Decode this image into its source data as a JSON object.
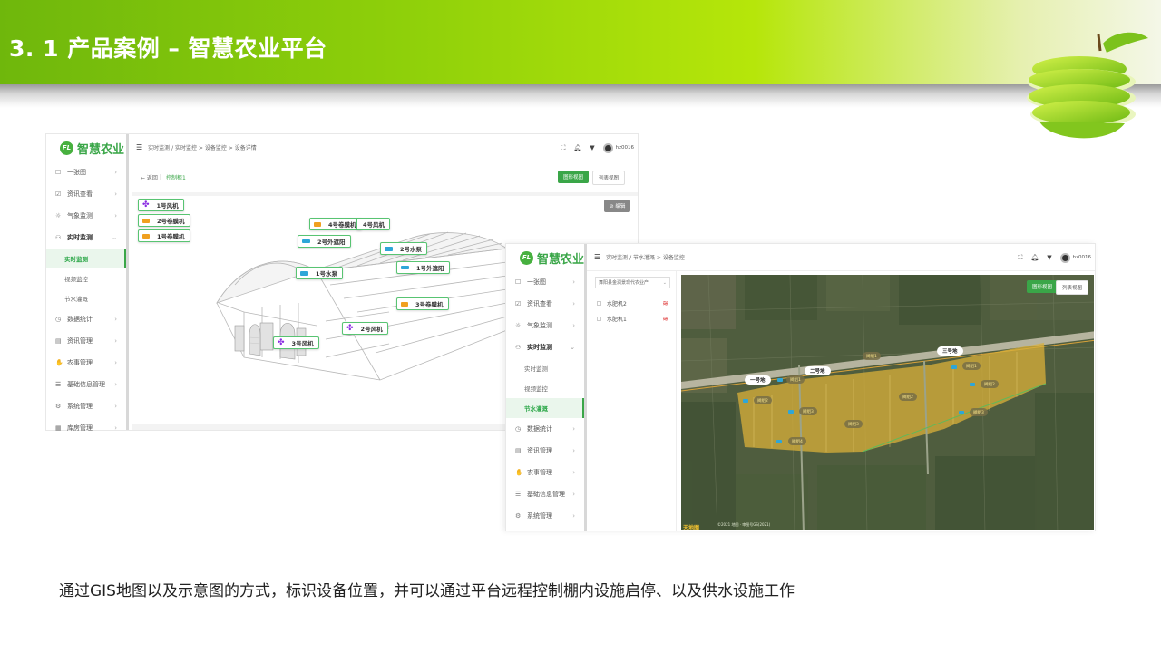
{
  "slide": {
    "title": "3. 1 产品案例 – 智慧农业平台",
    "caption": "通过GIS地图以及示意图的方式，标识设备位置，并可以通过平台远程控制棚内设施启停、以及供水设施工作"
  },
  "app": {
    "logo_mark": "FL",
    "logo_text": "智慧农业",
    "user": "hz0016",
    "menu": [
      {
        "label": "一张图",
        "icon": "☐"
      },
      {
        "label": "资讯查看",
        "icon": "☑"
      },
      {
        "label": "气象监测",
        "icon": "☼"
      },
      {
        "label": "实时监测",
        "icon": "⚇"
      },
      {
        "label": "数据统计",
        "icon": "◷"
      },
      {
        "label": "资讯管理",
        "icon": "▤"
      },
      {
        "label": "农事管理",
        "icon": "✋"
      },
      {
        "label": "基础信息管理",
        "icon": "☰"
      },
      {
        "label": "系统管理",
        "icon": "⚙"
      },
      {
        "label": "库房管理",
        "icon": "▦"
      }
    ],
    "sub_menu": [
      "实时监测",
      "视频监控",
      "节水灌溉"
    ]
  },
  "screen1": {
    "breadcrumb": "实时监测  /  实时监控 > 设备监控 > 设备详情",
    "back_label": "← 返回",
    "back_target": "控制柜1",
    "view_diagram": "图形视图",
    "view_list": "列表视图",
    "edit_label": "⊘ 编辑",
    "devices": [
      {
        "label": "1号风机",
        "type": "fan"
      },
      {
        "label": "2号卷膜机",
        "type": "film"
      },
      {
        "label": "1号卷膜机",
        "type": "film"
      },
      {
        "label": "4号卷膜机",
        "type": "film"
      },
      {
        "label": "4号风机",
        "type": "fan"
      },
      {
        "label": "2号外遮阳",
        "type": "shade"
      },
      {
        "label": "2号水泵",
        "type": "pump"
      },
      {
        "label": "1号外遮阳",
        "type": "shade"
      },
      {
        "label": "1号水泵",
        "type": "pump"
      },
      {
        "label": "3号卷膜机",
        "type": "film"
      },
      {
        "label": "2号风机",
        "type": "fan"
      },
      {
        "label": "3号风机",
        "type": "fan"
      }
    ]
  },
  "screen2": {
    "breadcrumb": "实时监测  /  节水灌溉 > 设备监控",
    "select_value": "舞阳县金润景现代农业产",
    "device_list": [
      {
        "label": "水肥机2"
      },
      {
        "label": "水肥机1"
      }
    ],
    "view_diagram": "图形视图",
    "view_list": "列表视图",
    "field_labels": [
      "一号地",
      "二号地",
      "三号地"
    ],
    "chips": [
      "阀组1",
      "阀组2",
      "阀组3",
      "阀组4",
      "阀组1",
      "阀组2",
      "阀组3",
      "阀组1",
      "阀组2",
      "阀组3"
    ],
    "copyright": "©2021 地图 · 审图号GS(2021)"
  },
  "colors": {
    "brand_green": "#3aa648",
    "banner_start": "#6fb70c",
    "field_yellow": "#e0b43a"
  }
}
